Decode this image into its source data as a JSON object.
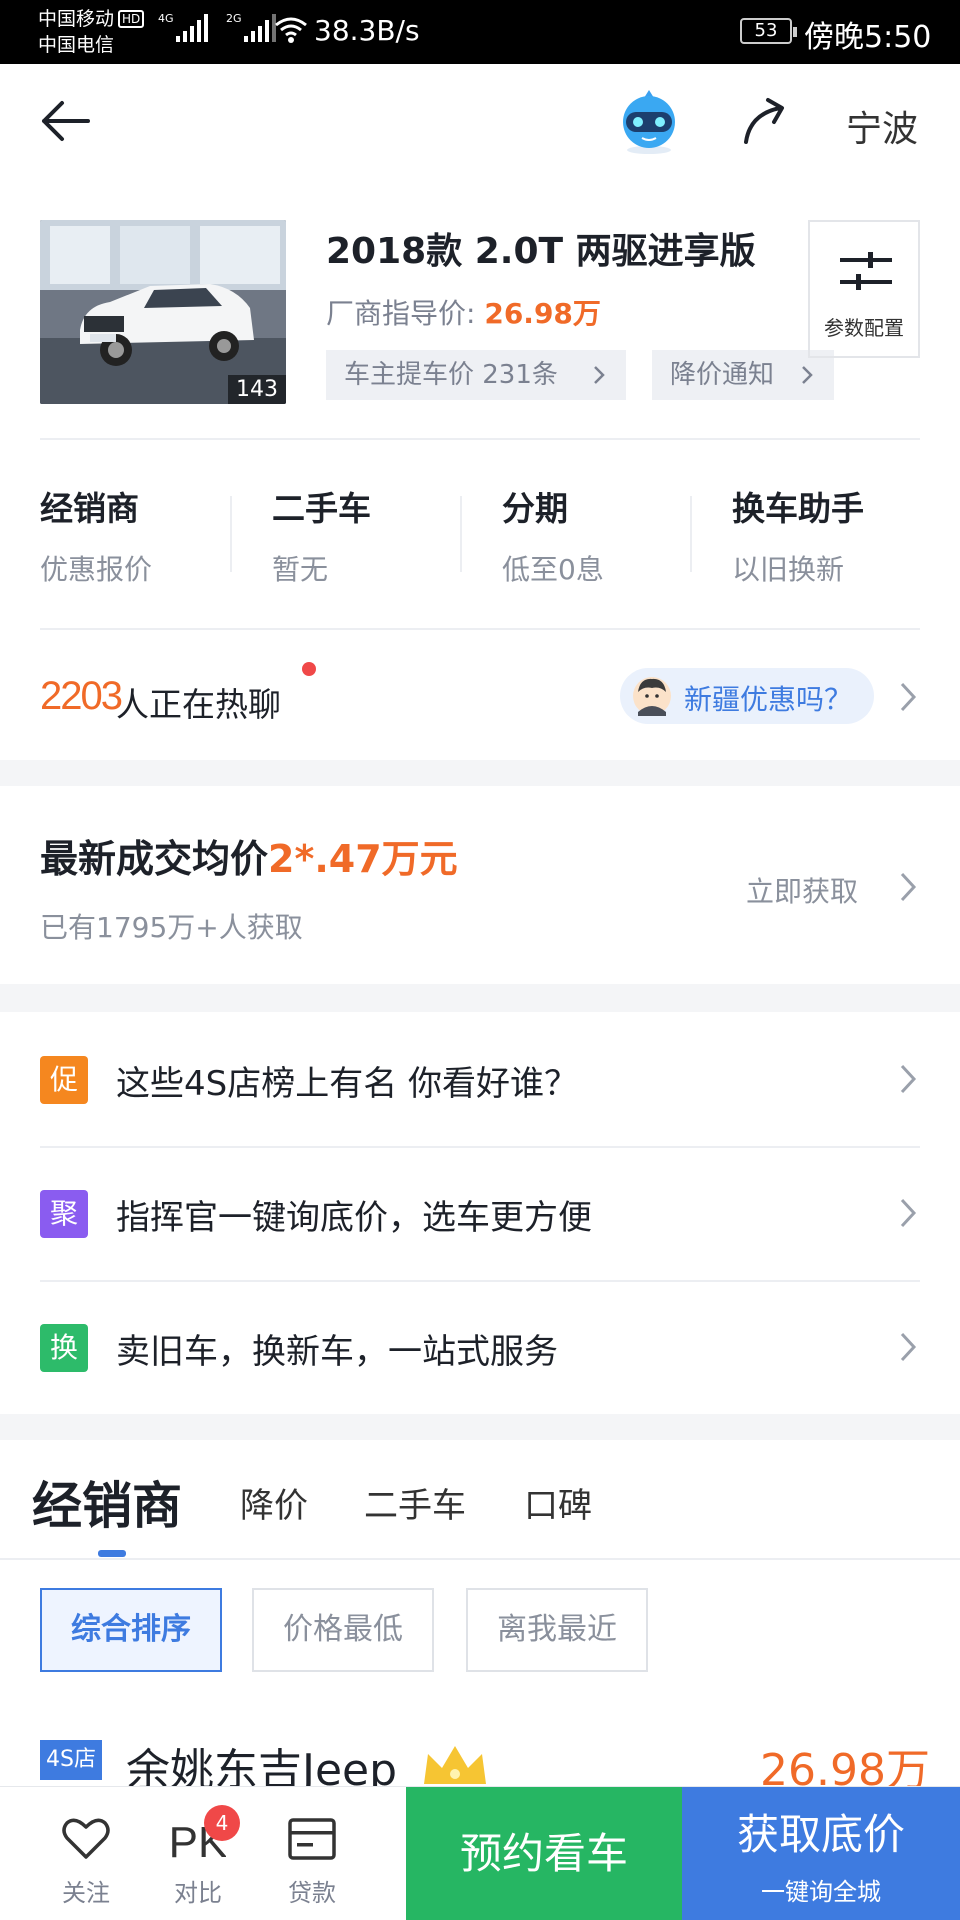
{
  "status_bar": {
    "carrier_1": "中国移动",
    "hd": "HD",
    "carrier_2": "中国电信",
    "net_1": "4G",
    "net_2": "2G",
    "speed": "38.3B/s",
    "battery": "53",
    "time": "傍晚5:50"
  },
  "header": {
    "city": "宁波"
  },
  "car": {
    "title": "2018款 2.0T 两驱进享版",
    "guide_price_label": "厂商指导价:",
    "guide_price": "26.98万",
    "photo_count": "143",
    "chip_owner_price": "车主提车价 231条",
    "chip_price_alert": "降价通知",
    "param_label": "参数配置"
  },
  "quick_links": [
    {
      "title": "经销商",
      "sub": "优惠报价"
    },
    {
      "title": "二手车",
      "sub": "暂无"
    },
    {
      "title": "分期",
      "sub": "低至0息"
    },
    {
      "title": "换车助手",
      "sub": "以旧换新"
    }
  ],
  "chat": {
    "count": "2203",
    "text": "人正在热聊",
    "question": "新疆优惠吗？"
  },
  "deal": {
    "title": "最新成交均价",
    "price": "2*.47万元",
    "sub": "已有1795万+人获取",
    "link": "立即获取"
  },
  "promos": [
    {
      "badge": "促",
      "color": "#f5871f",
      "text": "这些4S店榜上有名 你看好谁？"
    },
    {
      "badge": "聚",
      "color": "#8a5cf0",
      "text": "指挥官一键询底价，选车更方便"
    },
    {
      "badge": "换",
      "color": "#2dbb6a",
      "text": "卖旧车，换新车，一站式服务"
    }
  ],
  "tabs": {
    "main": "经销商",
    "t1": "降价",
    "t2": "二手车",
    "t3": "口碑"
  },
  "sort": {
    "s1": "综合排序",
    "s2": "价格最低",
    "s3": "离我最近"
  },
  "dealer": {
    "badge": "4S店",
    "name": "余姚东吉Jeep",
    "price": "26.98万"
  },
  "bottom": {
    "follow": "关注",
    "compare": "对比",
    "compare_badge": "4",
    "loan": "贷款",
    "book": "预约看车",
    "get_price": "获取底价",
    "get_price_sub": "一键询全城"
  },
  "colors": {
    "accent": "#3e7be0",
    "orange": "#f06a28",
    "green": "#26b663"
  }
}
